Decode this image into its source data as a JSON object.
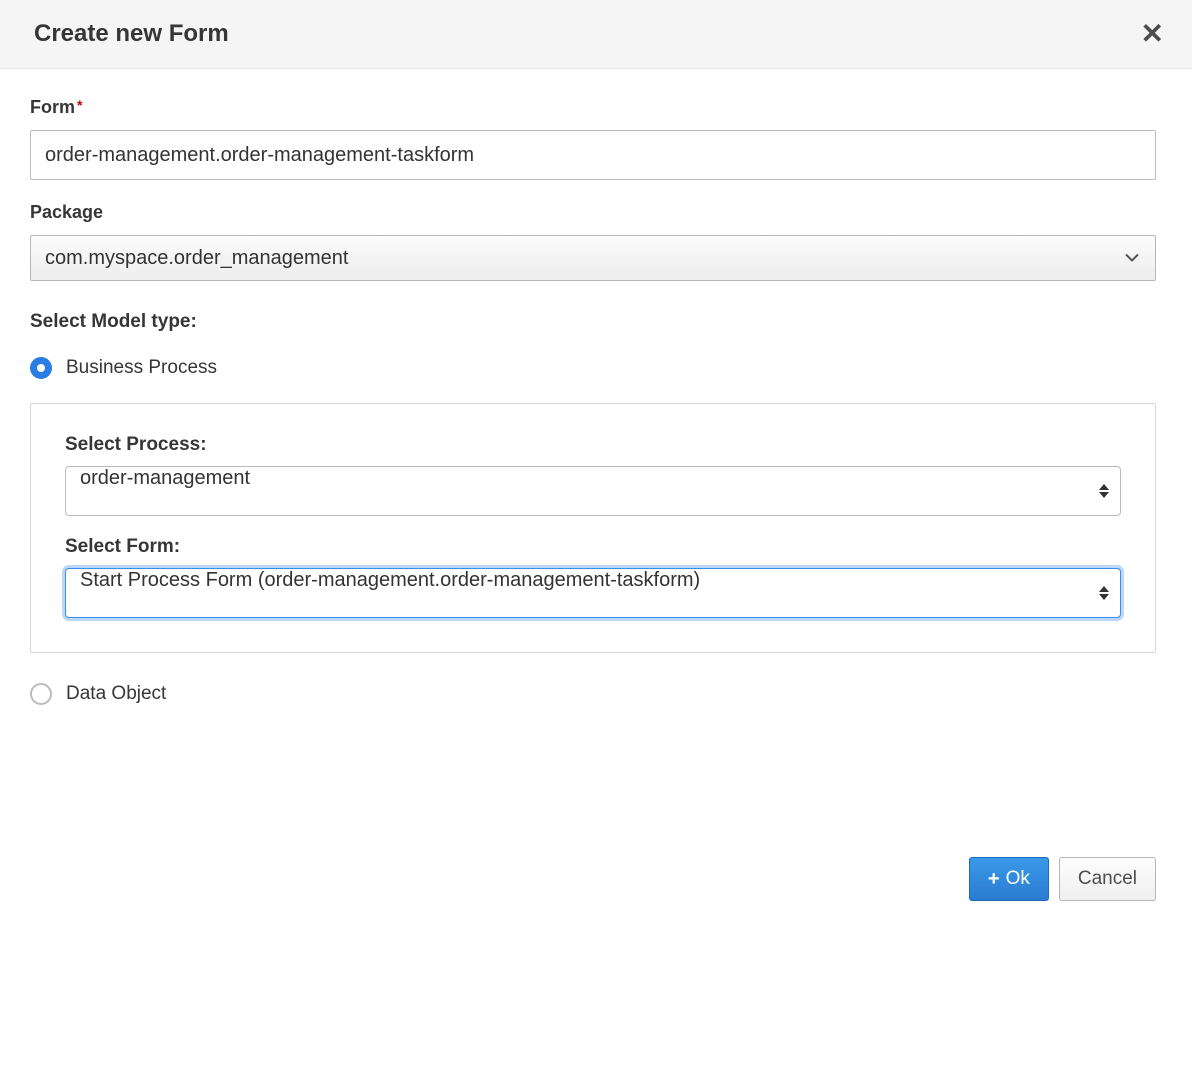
{
  "header": {
    "title": "Create new Form"
  },
  "form": {
    "form_label": "Form",
    "form_value": "order-management.order-management-taskform",
    "package_label": "Package",
    "package_value": "com.myspace.order_management"
  },
  "model": {
    "section_label": "Select Model type:",
    "business_process_label": "Business Process",
    "data_object_label": "Data Object",
    "select_process_label": "Select Process:",
    "select_process_value": "order-management",
    "select_form_label": "Select Form:",
    "select_form_value": "Start Process Form (order-management.order-management-taskform)"
  },
  "footer": {
    "ok_label": "Ok",
    "cancel_label": "Cancel"
  }
}
